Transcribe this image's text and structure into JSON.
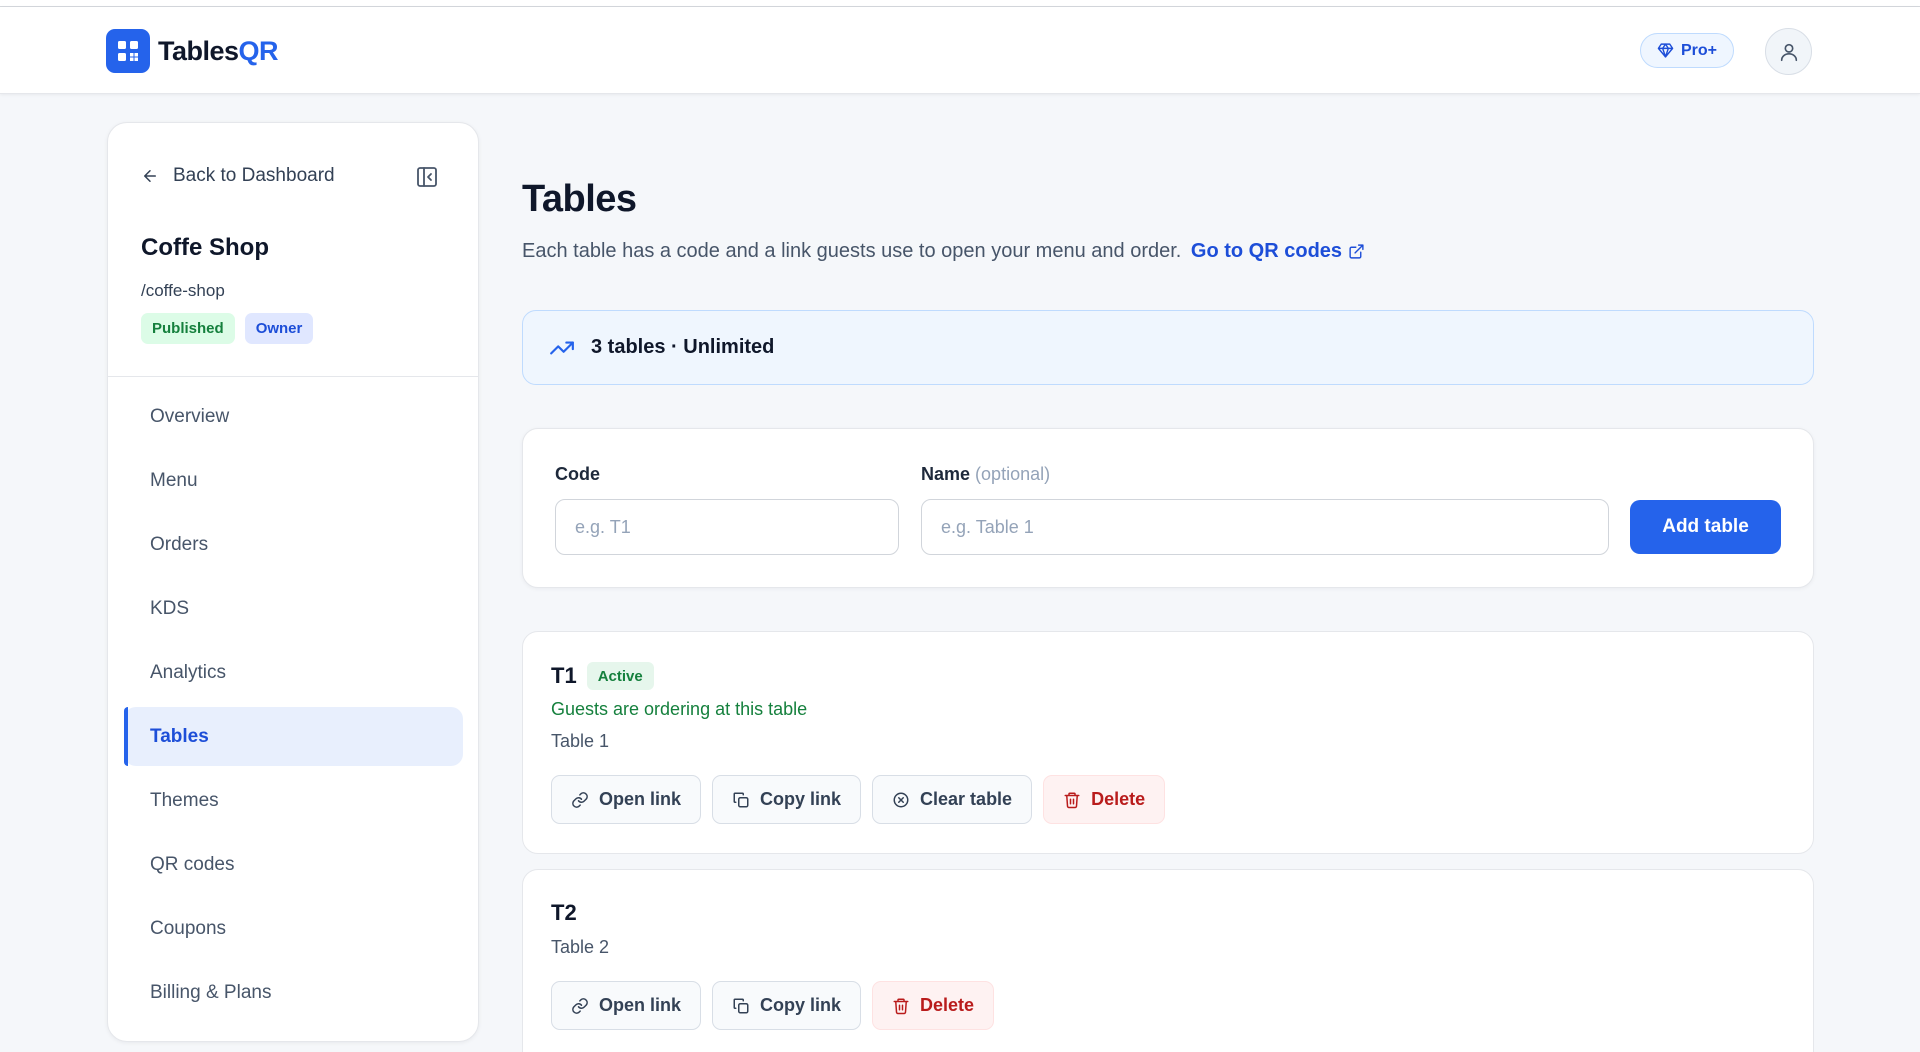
{
  "header": {
    "logo_prefix": "Tables",
    "logo_accent": "QR",
    "plan_label": "Pro+"
  },
  "sidebar": {
    "back_label": "Back to Dashboard",
    "shop_name": "Coffe Shop",
    "shop_slug": "/coffe-shop",
    "badge_published": "Published",
    "badge_owner": "Owner",
    "nav": [
      "Overview",
      "Menu",
      "Orders",
      "KDS",
      "Analytics",
      "Tables",
      "Themes",
      "QR codes",
      "Coupons",
      "Billing & Plans"
    ],
    "active_item": "Tables"
  },
  "main": {
    "title": "Tables",
    "subtitle": "Each table has a code and a link guests use to open your menu and order.",
    "qr_link": "Go to QR codes",
    "summary": "3 tables · Unlimited",
    "form": {
      "code_label": "Code",
      "code_placeholder": "e.g. T1",
      "name_label": "Name",
      "name_optional": "(optional)",
      "name_placeholder": "e.g. Table 1",
      "add_button": "Add table"
    },
    "tables": [
      {
        "code": "T1",
        "status": "Active",
        "note": "Guests are ordering at this table",
        "name": "Table 1",
        "actions": [
          "Open link",
          "Copy link",
          "Clear table",
          "Delete"
        ]
      },
      {
        "code": "T2",
        "name": "Table 2",
        "actions": [
          "Open link",
          "Copy link",
          "Delete"
        ]
      }
    ]
  },
  "colors": {
    "accent": "#2563eb",
    "success": "#15803d",
    "danger": "#b91c1c"
  }
}
